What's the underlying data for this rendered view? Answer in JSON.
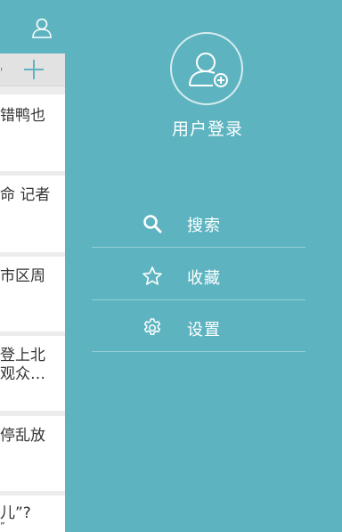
{
  "underlay": {
    "tick": "'",
    "news": [
      {
        "line1": "错鸭也",
        "line2": ""
      },
      {
        "line1": "命 记者",
        "line2": ""
      },
      {
        "line1": "市区周",
        "line2": ""
      },
      {
        "line1": "登上北",
        "line2": "观众…"
      },
      {
        "line1": "停乱放",
        "line2": ""
      },
      {
        "line1": "儿”?",
        "line2": "”"
      }
    ]
  },
  "drawer": {
    "login_label": "用户登录",
    "menu": [
      {
        "icon": "search-icon",
        "label": "搜索"
      },
      {
        "icon": "star-icon",
        "label": "收藏"
      },
      {
        "icon": "gear-icon",
        "label": "设置"
      }
    ]
  },
  "colors": {
    "accent": "#5db4c0",
    "underlay_bg": "#ececec",
    "card_bg": "#ffffff"
  }
}
